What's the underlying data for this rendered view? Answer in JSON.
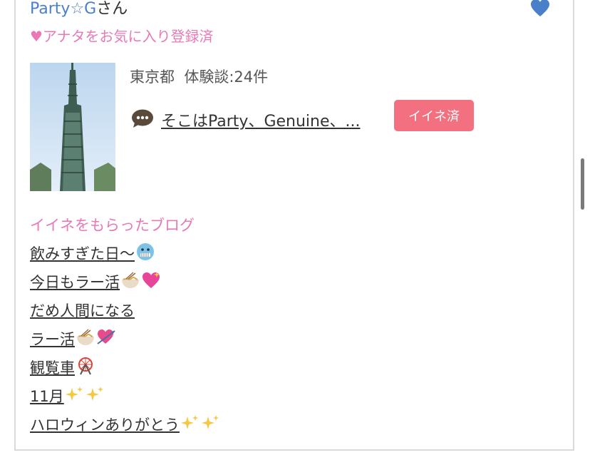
{
  "profile": {
    "name": "Party☆G",
    "honorific": "さん",
    "favorite_status": "♥アナタをお気に入り登録済",
    "location": "東京都",
    "review_count_text": "体験談:24件",
    "review_preview": "そこはParty、Genuine、...",
    "like_button_label": "イイネ済",
    "heart_icon": "heart-icon",
    "chat_icon": "speech-bubble-icon"
  },
  "blogs": {
    "section_title": "イイネをもらったブログ",
    "items": [
      {
        "title": "飲みすぎた日〜",
        "emoji": [
          "cold-face"
        ]
      },
      {
        "title": "今日もラー活",
        "emoji": [
          "ramen",
          "sparkling-heart"
        ]
      },
      {
        "title": "だめ人間になる",
        "emoji": []
      },
      {
        "title": "ラー活",
        "emoji": [
          "ramen",
          "heart-arrow"
        ]
      },
      {
        "title": "観覧車",
        "emoji": [
          "ferris-wheel"
        ]
      },
      {
        "title": "11月",
        "emoji": [
          "sparkles",
          "sparkles"
        ]
      },
      {
        "title": "ハロウィンありがとう",
        "emoji": [
          "sparkles",
          "sparkles"
        ]
      }
    ]
  },
  "colors": {
    "name": "#4a7fc9",
    "pink_text": "#e879b5",
    "button": "#f27080",
    "border": "#d9d9d9"
  }
}
